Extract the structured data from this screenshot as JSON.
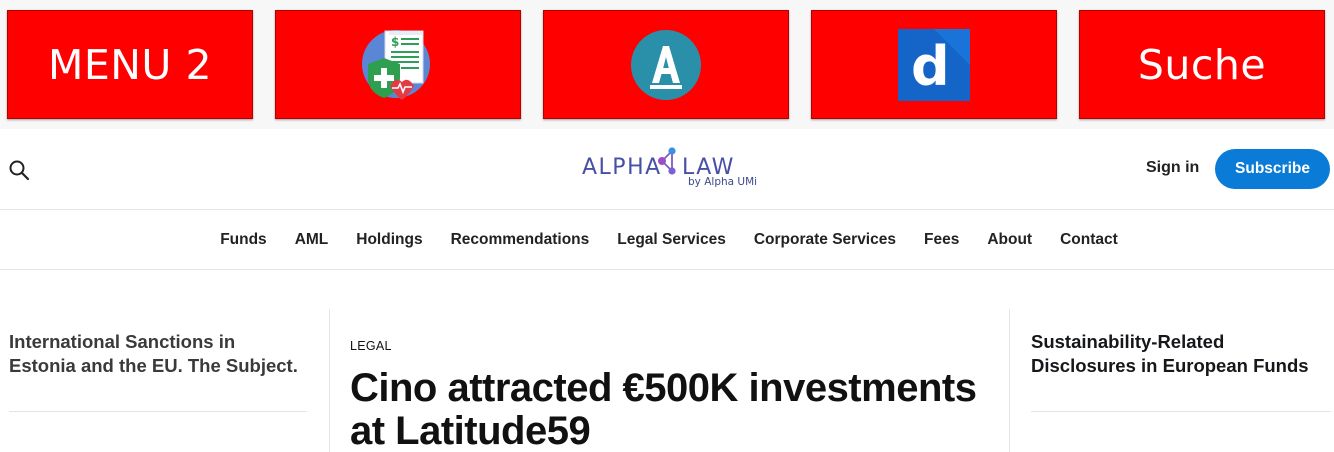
{
  "promo_bar": {
    "tiles": [
      {
        "label": "MENU 2",
        "icon": null
      },
      {
        "label": "",
        "icon": "health-insurance-invoice-icon"
      },
      {
        "label": "",
        "icon": "letter-a-circle-icon"
      },
      {
        "label": "",
        "icon": "letter-d-square-icon"
      },
      {
        "label": "Suche",
        "icon": null
      }
    ],
    "color": "#ff0000"
  },
  "header": {
    "search_icon": "search-icon",
    "logo": {
      "name": "ALPHA LAW",
      "tagline": "by Alpha UMi"
    },
    "signin_label": "Sign in",
    "subscribe_label": "Subscribe",
    "accent": "#0a7bd6"
  },
  "nav": {
    "items": [
      "Funds",
      "AML",
      "Holdings",
      "Recommendations",
      "Legal Services",
      "Corporate Services",
      "Fees",
      "About",
      "Contact"
    ]
  },
  "content": {
    "left_teaser": "International Sanctions in Estonia and the EU. The Subject.",
    "main": {
      "tag": "LEGAL",
      "headline": "Cino attracted €500K investments at Latitude59"
    },
    "right_teaser": "Sustainability-Related Disclosures in European Funds"
  }
}
